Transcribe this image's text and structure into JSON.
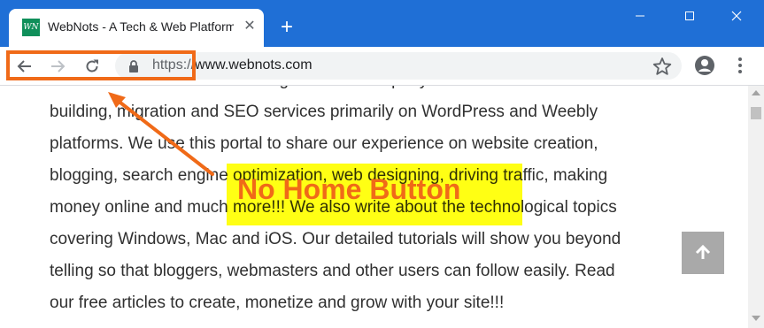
{
  "tab": {
    "favicon_text": "WN",
    "title": "WebNots - A Tech & Web Platform",
    "close_glyph": "✕",
    "new_tab_glyph": "+"
  },
  "window_controls": {
    "minimize": "—",
    "maximize": "☐",
    "close": "✕"
  },
  "omnibox": {
    "scheme": "https://",
    "host": "www.webnots.com"
  },
  "content": {
    "lines": [
      "WebNots is an online consulting services company offers end to end site",
      "building, migration and SEO services primarily on WordPress and Weebly",
      "platforms. We use this portal to share our experience on website creation,",
      "blogging, search engine optimization, web designing, driving traffic, making",
      "money online and much more!!! We also write about the technological topics",
      "covering Windows, Mac and iOS. Our detailed tutorials will show you beyond",
      "telling so that bloggers, webmasters and other users can follow easily. Read",
      "our free articles to create, monetize and grow with your site!!!"
    ]
  },
  "annotation": {
    "label": "No Home Button",
    "color": "#f06a18",
    "label_background": "#ffff00"
  },
  "icons": {
    "back": "arrow-left-icon",
    "forward": "arrow-right-icon",
    "reload": "reload-icon",
    "lock": "lock-icon",
    "star": "star-icon",
    "account": "account-icon",
    "menu": "kebab-menu-icon",
    "scroll_top": "arrow-up-icon"
  },
  "colors": {
    "tabstrip": "#1f6fd6",
    "favicon": "#0f8f5a",
    "scroll_top_button": "#a9a9a9"
  }
}
